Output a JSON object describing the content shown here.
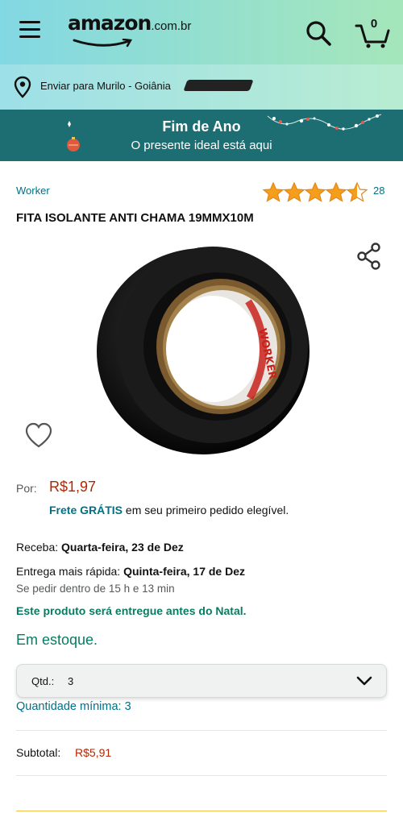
{
  "header": {
    "logo_text": "amazon",
    "logo_suffix": ".com.br",
    "cart_count": "0",
    "icons": [
      "menu-icon",
      "search-icon",
      "cart-icon"
    ]
  },
  "delivery": {
    "text": "Enviar para Murilo - Goiânia",
    "icon": "location-pin-icon"
  },
  "promo": {
    "title": "Fim de Ano",
    "subtitle": "O presente ideal está aqui"
  },
  "product": {
    "brand": "Worker",
    "rating": 4.5,
    "rating_count": "28",
    "title": "FITA ISOLANTE ANTI CHAMA 19MMX10M",
    "image_label": "WORKER",
    "price_label": "Por:",
    "price": "R$1,97",
    "shipping_free": "Frete GRÁTIS",
    "shipping_rest": " em seu primeiro pedido elegível."
  },
  "delivery_info": {
    "receive_label": "Receba: ",
    "receive_date": "Quarta-feira, 23 de Dez",
    "fast_label": "Entrega mais rápida: ",
    "fast_date": "Quinta-feira, 17 de Dez",
    "order_within": "Se pedir dentro de 15 h e 13 min",
    "christmas_note": "Este produto será entregue antes do Natal."
  },
  "stock": "Em estoque.",
  "quantity": {
    "label": "Qtd.:",
    "value": "3",
    "minimum": "Quantidade mínima: 3"
  },
  "subtotal": {
    "label": "Subtotal: ",
    "value": "R$5,91"
  },
  "colors": {
    "link": "#007185",
    "price": "#b12704",
    "success": "#067d62",
    "star": "#f59e1b",
    "promo_bg": "#1c6e73"
  }
}
